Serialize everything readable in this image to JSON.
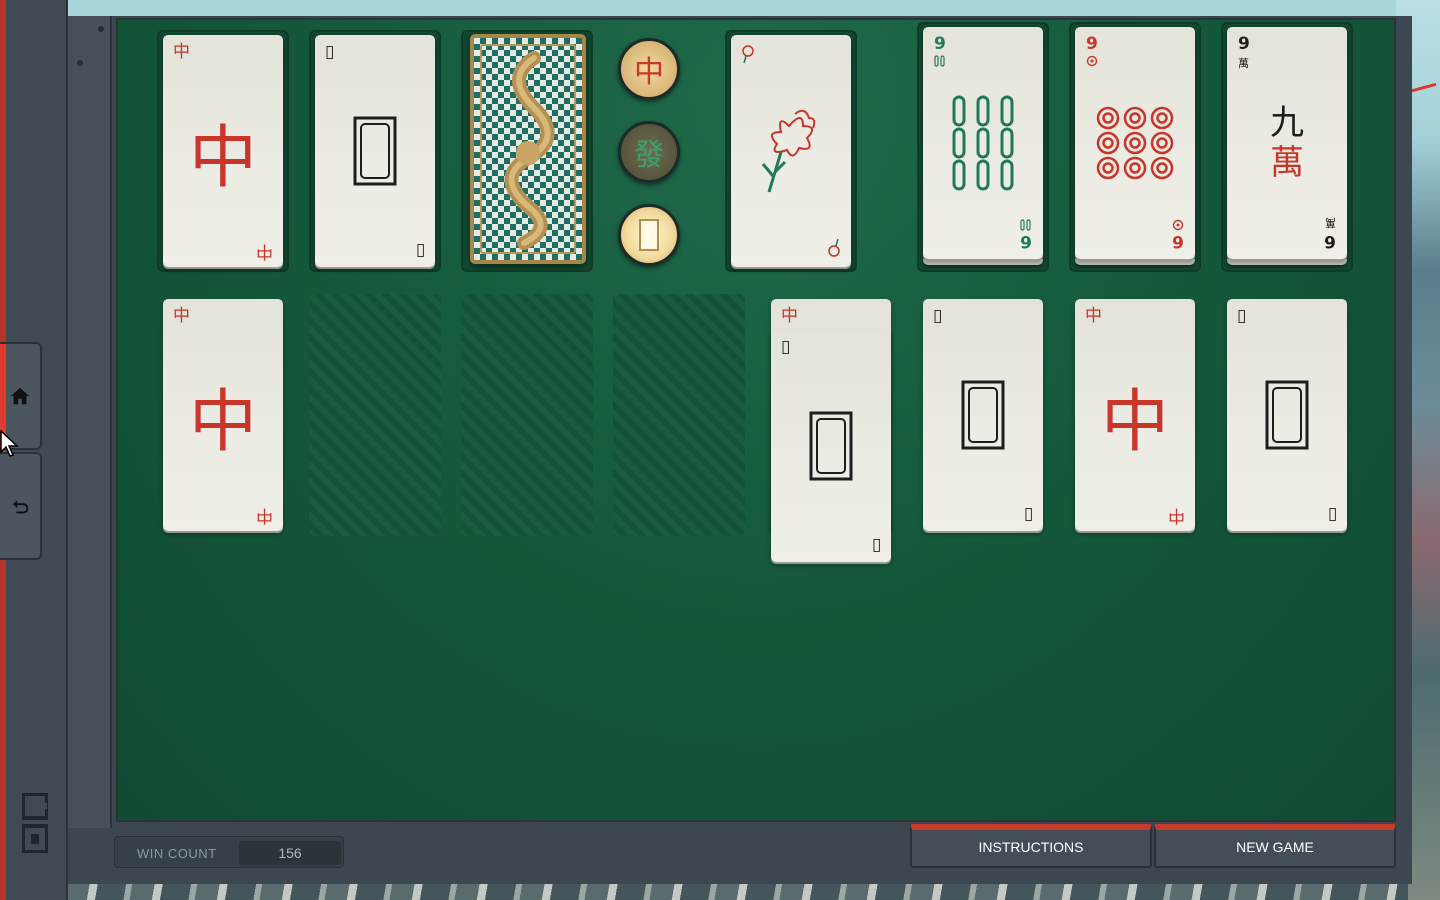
{
  "sidebar": {
    "home_icon": "home-icon",
    "undo_icon": "undo-icon"
  },
  "board": {
    "free_cells": [
      {
        "tile": "red-dragon",
        "top": "中",
        "bottom": "中",
        "color": "#c8352a"
      },
      {
        "tile": "white-dragon",
        "top": "▯",
        "bottom": "▯",
        "color": "#1e1e1e"
      },
      {
        "tile": "card-back-dragon"
      }
    ],
    "dragon_buttons": [
      {
        "glyph": "中",
        "name": "red-dragon"
      },
      {
        "glyph": "發",
        "name": "green-dragon"
      },
      {
        "glyph": "▯",
        "name": "white-dragon"
      }
    ],
    "flower_cell": {
      "tile": "flower"
    },
    "foundations": [
      {
        "suit": "bamboo",
        "top_rank": "9",
        "bottom_rank": "6",
        "big_char": "",
        "color": "#1f7a5a"
      },
      {
        "suit": "circles",
        "top_rank": "9",
        "bottom_rank": "6",
        "big_char": "",
        "color": "#c8352a"
      },
      {
        "suit": "characters",
        "top_rank": "9",
        "bottom_rank": "6",
        "big_top": "九",
        "big_bottom": "萬",
        "suit_mark": "萬",
        "color": "#1e1e1e"
      }
    ],
    "tableau": [
      {
        "column": 1,
        "cards": [
          {
            "tile": "red-dragon",
            "glyph": "中"
          }
        ]
      },
      {
        "column": 2,
        "cards": []
      },
      {
        "column": 3,
        "cards": []
      },
      {
        "column": 4,
        "cards": []
      },
      {
        "column": 5,
        "cards": [
          {
            "tile": "red-dragon",
            "glyph": "中"
          },
          {
            "tile": "white-dragon",
            "glyph": "▯"
          }
        ]
      },
      {
        "column": 6,
        "cards": [
          {
            "tile": "white-dragon",
            "glyph": "▯"
          }
        ]
      },
      {
        "column": 7,
        "cards": [
          {
            "tile": "red-dragon",
            "glyph": "中"
          }
        ]
      },
      {
        "column": 8,
        "cards": [
          {
            "tile": "white-dragon",
            "glyph": "▯"
          }
        ]
      }
    ]
  },
  "footer": {
    "win_count_label": "WIN COUNT",
    "win_count_value": "156",
    "instructions_label": "INSTRUCTIONS",
    "new_game_label": "NEW GAME"
  },
  "colors": {
    "felt": "#155a3c",
    "accent_red": "#c73a2c",
    "frame": "#3d474f"
  }
}
